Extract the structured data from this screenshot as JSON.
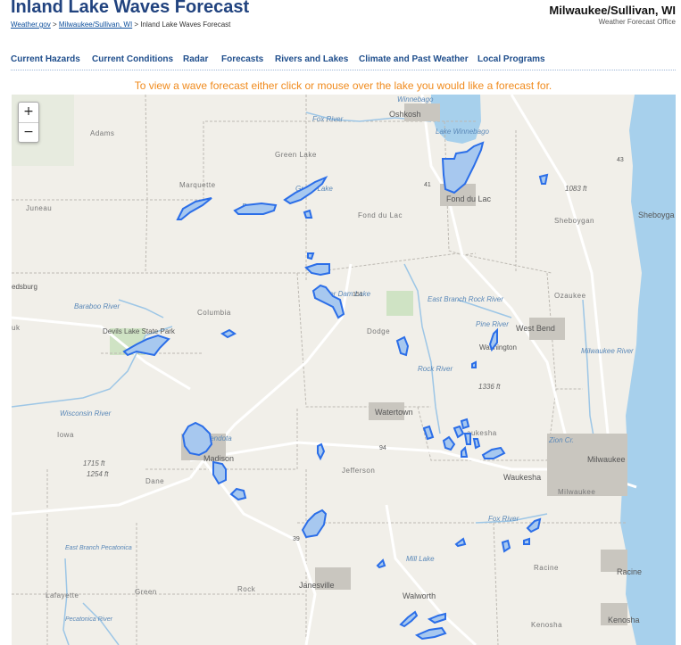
{
  "header": {
    "title": "Inland Lake Waves Forecast",
    "breadcrumb": {
      "home": "Weather.gov",
      "sep1": ">",
      "office": "Milwaukee/Sullivan, WI",
      "sep2": ">",
      "current": "Inland Lake Waves Forecast"
    },
    "office_name": "Milwaukee/Sullivan, WI",
    "office_sub": "Weather Forecast Office"
  },
  "nav": [
    "Current Hazards",
    "Current Conditions",
    "Radar",
    "Forecasts",
    "Rivers and Lakes",
    "Climate and Past Weather",
    "Local Programs"
  ],
  "instructions": "To view a wave forecast either click or mouse over the lake you would like a forecast for.",
  "map": {
    "zoom_in": "+",
    "zoom_out": "−",
    "places": {
      "oshkosh": "Oshkosh",
      "winnebago_top": "Winnebago",
      "fond_du_lac_city": "Fond du Lac",
      "fond_du_lac_county": "Fond du Lac",
      "adams": "Adams",
      "green_lake": "Green Lake",
      "marquette": "Marquette",
      "juneau": "Juneau",
      "sheboygan_county": "Sheboygan",
      "sheboygan_city": "Sheboyga",
      "columbia": "Columbia",
      "dodge": "Dodge",
      "ozaukee": "Ozaukee",
      "west_bend": "West Bend",
      "washington": "Washington",
      "reedsburg": "edsburg",
      "sauk": "uk",
      "devils_lake": "Devils Lake State Park",
      "watertown": "Watertown",
      "waukesha_county": "aukesha",
      "milwaukee": "Milwaukee",
      "iowa": "Iowa",
      "madison": "Madison",
      "dane": "Dane",
      "jefferson": "Jefferson",
      "waukesha_city": "Waukesha",
      "milwaukee_county": "Milwaukee",
      "racine_county": "Racine",
      "racine_city": "Racine",
      "janesville": "Janesville",
      "walworth": "Walworth",
      "kenosha_county": "Kenosha",
      "kenosha_city": "Kenosha",
      "lafayette": "Lafayette",
      "green": "Green",
      "rock": "Rock"
    },
    "water_labels": {
      "fox_river_n": "Fox River",
      "lake_winnebago": "Lake Winnebago",
      "baraboo_river": "Baraboo River",
      "wisconsin_river": "Wisconsin River",
      "east_branch_rock": "East Branch Rock River",
      "rock_river": "Rock River",
      "milwaukee_river": "Milwaukee River",
      "fox_river_s": "Fox River",
      "mill_lake": "Mill Lake",
      "east_branch_pecatonica": "East Branch Pecatonica",
      "pecatonica_river": "Pecatonica River",
      "lake_mendota": "Lake Mendota",
      "beaver_dam": "Beaver Dam Lake",
      "puckaway": "Puckaway",
      "green_lake_water": "Green Lake",
      "pine_river": "Pine River",
      "zion_creek": "Zion Cr."
    },
    "elevations": {
      "e1083": "1083 ft",
      "e1336": "1336 ft",
      "e1715": "1715 ft",
      "e1254": "1254 ft"
    },
    "roads": {
      "i41": "41",
      "i151": "151",
      "i94": "94",
      "i39": "39",
      "i43": "43"
    },
    "colors": {
      "land": "#f1efe9",
      "water": "#a7d0ec",
      "lake_outline": "#2b6ee8",
      "lake_fill": "#a7c8ef",
      "county_line": "#b9b6b0",
      "road": "#ffffff",
      "instruction": "#f08a1c",
      "title": "#21437f"
    }
  }
}
